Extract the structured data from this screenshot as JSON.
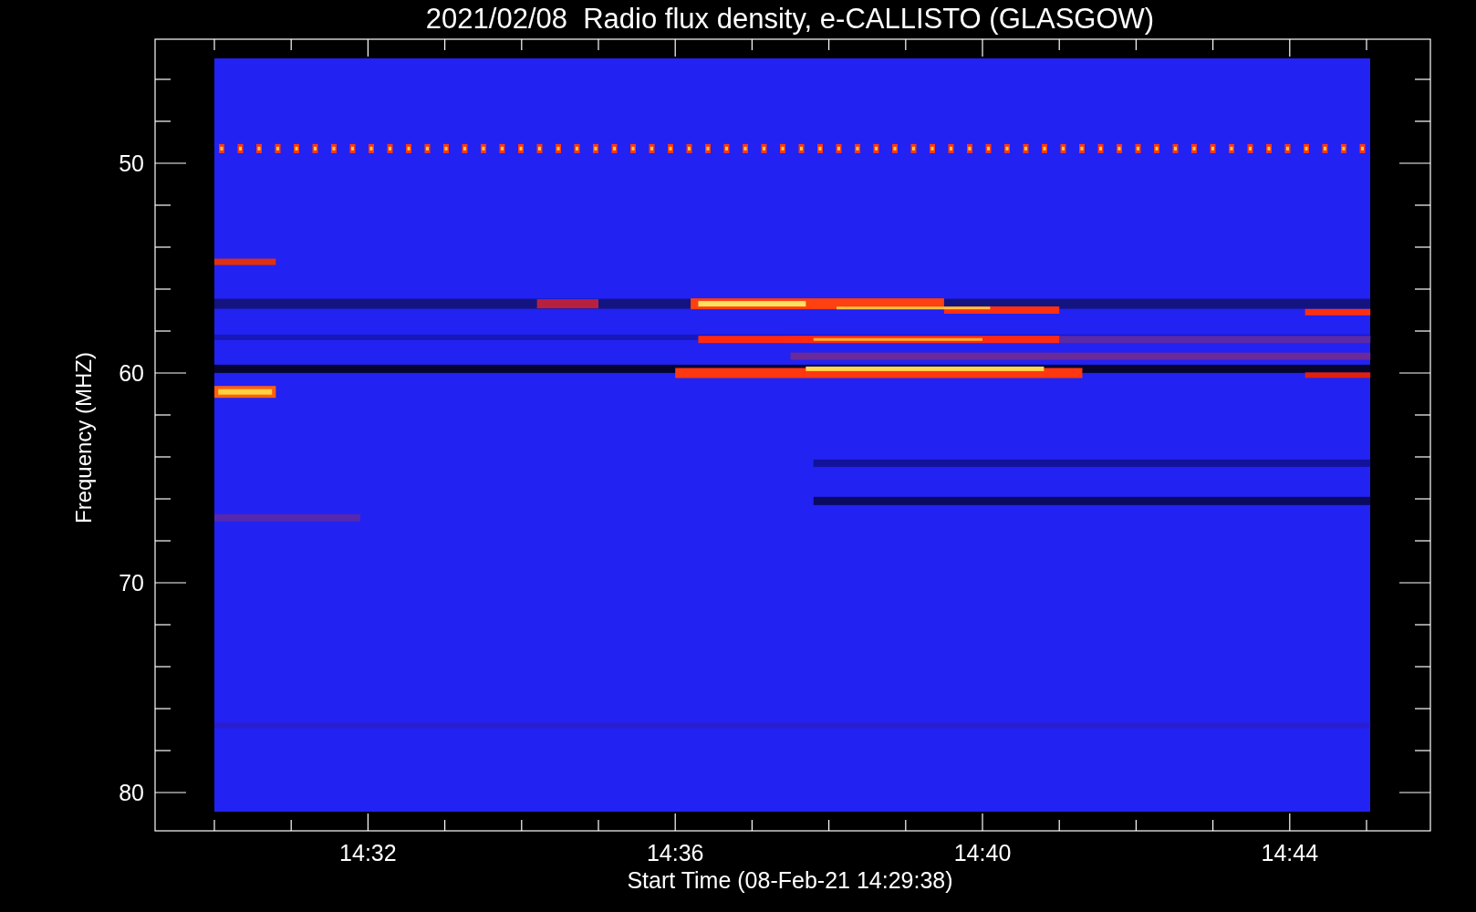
{
  "title": "2021/02/08  Radio flux density, e-CALLISTO (GLASGOW)",
  "y_axis": {
    "label": "Frequency (MHZ)",
    "ticks": [
      "50",
      "60",
      "70",
      "80"
    ]
  },
  "x_axis": {
    "label": "Start Time (08-Feb-21 14:29:38)",
    "ticks": [
      "14:32",
      "14:36",
      "14:40",
      "14:44"
    ]
  }
}
